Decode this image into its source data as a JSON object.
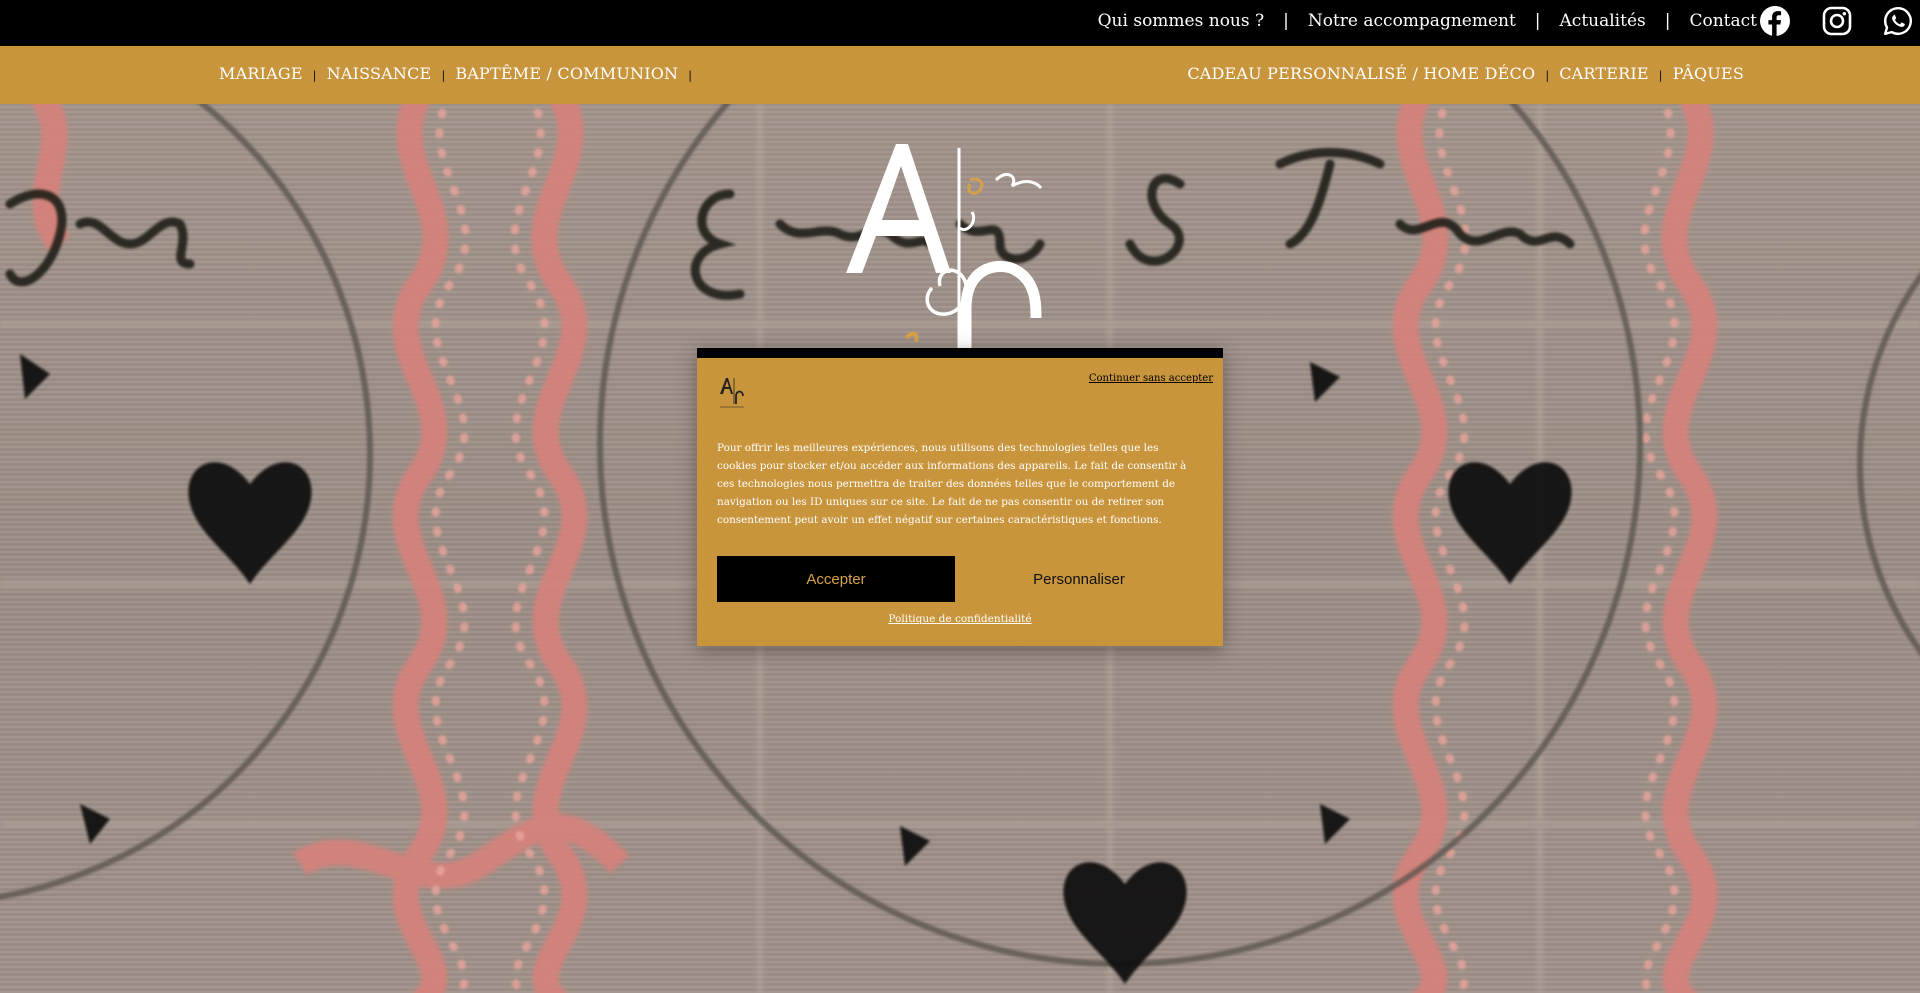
{
  "topbar": {
    "links": [
      "Qui sommes nous ?",
      "Notre accompagnement",
      "Actualités",
      "Contact"
    ],
    "separator": "|",
    "social": [
      "facebook-icon",
      "instagram-icon",
      "whatsapp-icon"
    ]
  },
  "navbar": {
    "left": [
      "MARIAGE",
      "NAISSANCE",
      "BAPTÊME / COMMUNION"
    ],
    "right": [
      "CADEAU PERSONNALISÉ / HOME DÉCO",
      "CARTERIE",
      "PÂQUES"
    ],
    "separator": "|"
  },
  "cookie": {
    "skip": "Continuer sans accepter",
    "text": "Pour offrir les meilleures expériences, nous utilisons des technologies telles que les cookies pour stocker et/ou accéder aux informations des appareils. Le fait de consentir à ces technologies nous permettra de traiter des données telles que le comportement de navigation ou les ID uniques sur ce site. Le fait de ne pas consentir ou de retirer son consentement peut avoir un effet négatif sur certaines caractéristiques et fonctions.",
    "accept": "Accepter",
    "customize": "Personnaliser",
    "policy": "Politique de confidentialité"
  },
  "colors": {
    "gold": "#c9953c",
    "black": "#000000",
    "accept_text": "#d6a04a"
  }
}
